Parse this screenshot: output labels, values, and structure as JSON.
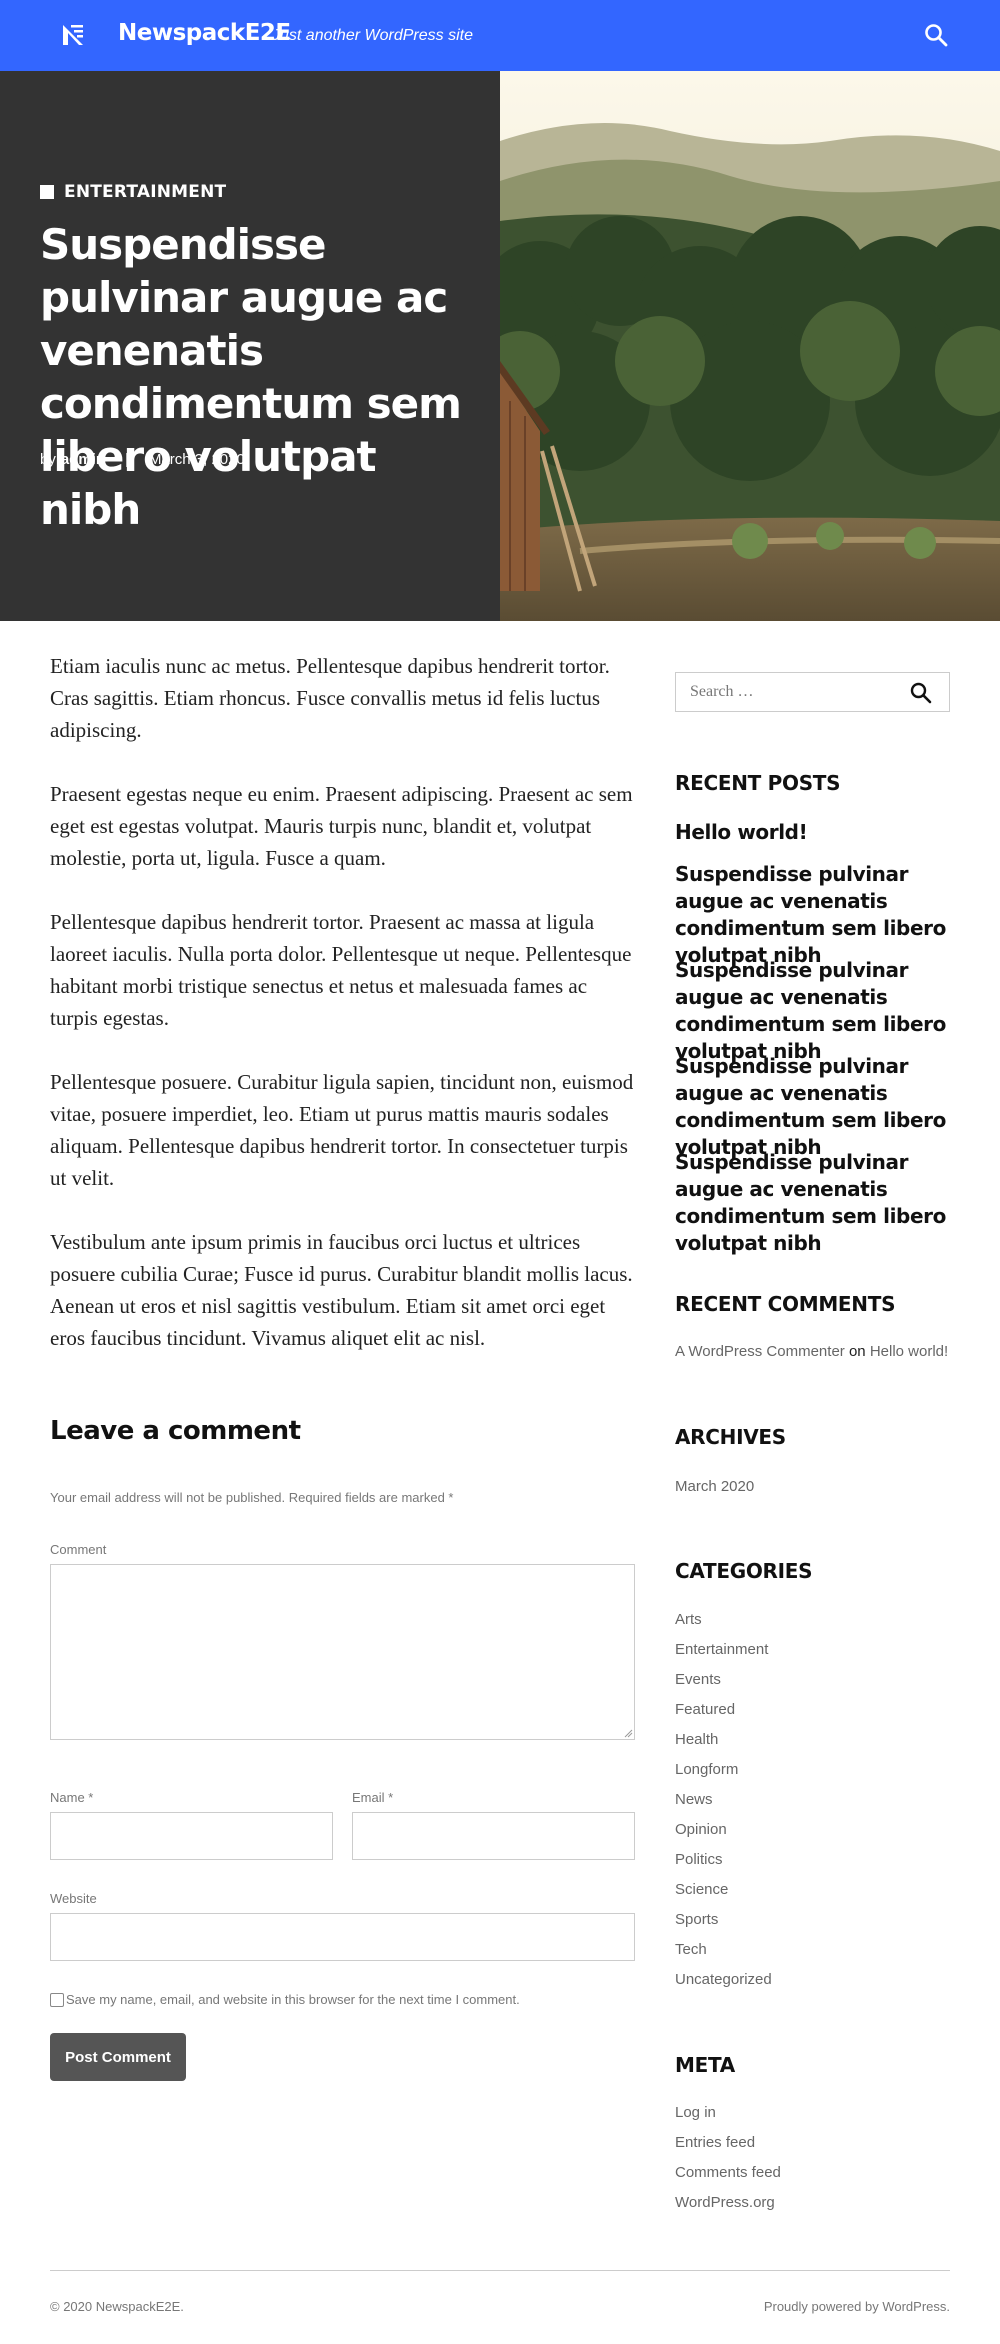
{
  "header": {
    "site_title": "NewspackE2E",
    "tagline": "Just another WordPress site",
    "logo_icon": "newspack-logo-icon",
    "search_icon": "search-icon",
    "background_color": "#3366ff"
  },
  "hero": {
    "category": "ENTERTAINMENT",
    "title": "Suspendisse pulvinar augue ac venenatis condimentum sem libero volutpat nibh",
    "by_label": "by",
    "author": "admin",
    "separator": "|",
    "date": "March 3, 2020"
  },
  "article": {
    "paragraphs": [
      "Etiam iaculis nunc ac metus. Pellentesque dapibus hendrerit tortor. Cras sagittis. Etiam rhoncus. Fusce convallis metus id felis luctus adipiscing.",
      "Praesent egestas neque eu enim. Praesent adipiscing. Praesent ac sem eget est egestas volutpat. Mauris turpis nunc, blandit et, volutpat molestie, porta ut, ligula. Fusce a quam.",
      "Pellentesque dapibus hendrerit tortor. Praesent ac massa at ligula laoreet iaculis. Nulla porta dolor. Pellentesque ut neque. Pellentesque habitant morbi tristique senectus et netus et malesuada fames ac turpis egestas.",
      "Pellentesque posuere. Curabitur ligula sapien, tincidunt non, euismod vitae, posuere imperdiet, leo. Etiam ut purus mattis mauris sodales aliquam. Pellentesque dapibus hendrerit tortor. In consectetuer turpis ut velit.",
      "Vestibulum ante ipsum primis in faucibus orci luctus et ultrices posuere cubilia Curae; Fusce id purus. Curabitur blandit mollis lacus. Aenean ut eros et nisl sagittis vestibulum. Etiam sit amet orci eget eros faucibus tincidunt. Vivamus aliquet elit ac nisl."
    ]
  },
  "comment_form": {
    "title": "Leave a comment",
    "note": "Your email address will not be published. Required fields are marked *",
    "comment_label": "Comment",
    "name_label": "Name *",
    "email_label": "Email *",
    "website_label": "Website",
    "save_label": "Save my name, email, and website in this browser for the next time I comment.",
    "submit_label": "Post Comment"
  },
  "sidebar": {
    "search_placeholder": "Search …",
    "recent_posts_title": "RECENT POSTS",
    "recent_posts": [
      "Hello world!",
      "Suspendisse pulvinar augue ac venenatis condimentum sem libero volutpat nibh",
      "Suspendisse pulvinar augue ac venenatis condimentum sem libero volutpat nibh",
      "Suspendisse pulvinar augue ac venenatis condimentum sem libero volutpat nibh",
      "Suspendisse pulvinar augue ac venenatis condimentum sem libero volutpat nibh"
    ],
    "recent_comments_title": "RECENT COMMENTS",
    "recent_comment": {
      "author": "A WordPress Commenter",
      "on": "on",
      "post": "Hello world!"
    },
    "archives_title": "ARCHIVES",
    "archives": [
      "March 2020"
    ],
    "categories_title": "CATEGORIES",
    "categories": [
      "Arts",
      "Entertainment",
      "Events",
      "Featured",
      "Health",
      "Longform",
      "News",
      "Opinion",
      "Politics",
      "Science",
      "Sports",
      "Tech",
      "Uncategorized"
    ],
    "meta_title": "META",
    "meta": [
      "Log in",
      "Entries feed",
      "Comments feed",
      "WordPress.org"
    ]
  },
  "footer": {
    "copyright": "© 2020 NewspackE2E.",
    "powered": "Proudly powered by WordPress."
  }
}
